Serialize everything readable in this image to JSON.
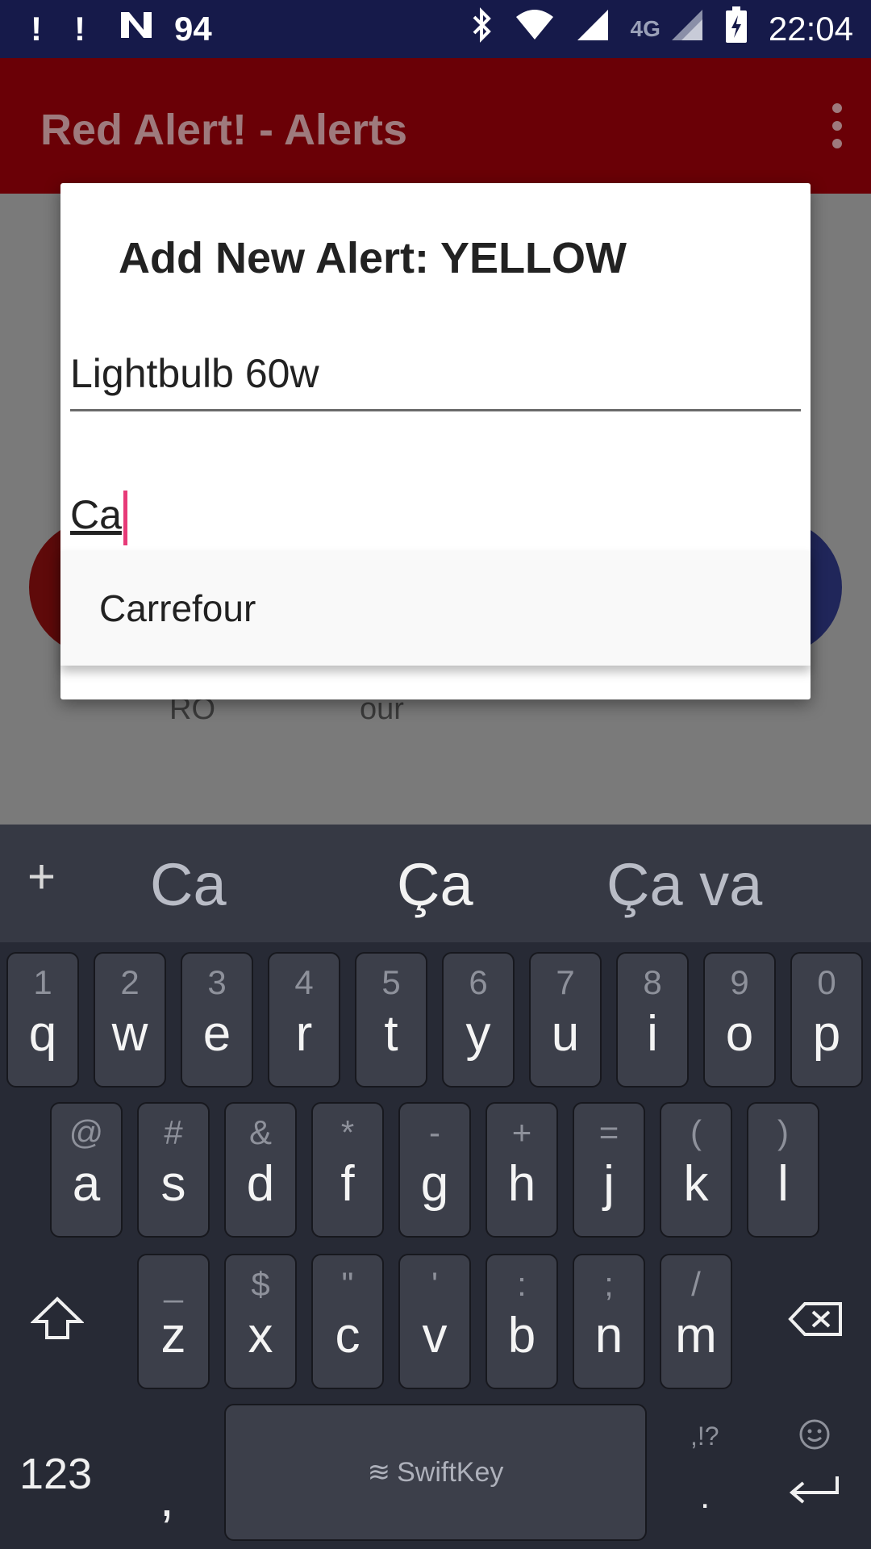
{
  "status_bar": {
    "notif1": "!",
    "notif2": "!",
    "notif3_icon": "n-icon",
    "battery_level_label": "94",
    "network": "4G",
    "time": "22:04"
  },
  "app_bar": {
    "title": "Red Alert! - Alerts",
    "menu_icon": "overflow-menu-icon"
  },
  "background": {
    "label_left": "RO",
    "label_mid": "our",
    "fab_plus": "+",
    "fab_colors": [
      "#5f0a0a",
      "#7a4a10",
      "#7a7210",
      "#20265a"
    ]
  },
  "dialog": {
    "title": "Add New Alert: YELLOW",
    "field1_value": "Lightbulb 60w",
    "field2_value": "Ca",
    "accent_color": "#e73a78"
  },
  "autocomplete": {
    "items": [
      "Carrefour"
    ]
  },
  "keyboard": {
    "predictions": [
      "Ca",
      "Ça",
      "Ça va"
    ],
    "plus": "+",
    "row1": [
      {
        "main": "q",
        "sub": "1"
      },
      {
        "main": "w",
        "sub": "2"
      },
      {
        "main": "e",
        "sub": "3"
      },
      {
        "main": "r",
        "sub": "4"
      },
      {
        "main": "t",
        "sub": "5"
      },
      {
        "main": "y",
        "sub": "6"
      },
      {
        "main": "u",
        "sub": "7"
      },
      {
        "main": "i",
        "sub": "8"
      },
      {
        "main": "o",
        "sub": "9"
      },
      {
        "main": "p",
        "sub": "0"
      }
    ],
    "row2": [
      {
        "main": "a",
        "sub": "@"
      },
      {
        "main": "s",
        "sub": "#"
      },
      {
        "main": "d",
        "sub": "&"
      },
      {
        "main": "f",
        "sub": "*"
      },
      {
        "main": "g",
        "sub": "-"
      },
      {
        "main": "h",
        "sub": "+"
      },
      {
        "main": "j",
        "sub": "="
      },
      {
        "main": "k",
        "sub": "("
      },
      {
        "main": "l",
        "sub": ")"
      }
    ],
    "row3": [
      {
        "main": "z",
        "sub": "_"
      },
      {
        "main": "x",
        "sub": "$"
      },
      {
        "main": "c",
        "sub": "\""
      },
      {
        "main": "v",
        "sub": "'"
      },
      {
        "main": "b",
        "sub": ":"
      },
      {
        "main": "n",
        "sub": ";"
      },
      {
        "main": "m",
        "sub": "/"
      }
    ],
    "numbers_label": "123",
    "comma": ",",
    "space_label": "SwiftKey",
    "punct_label": ",!?",
    "period": "."
  }
}
